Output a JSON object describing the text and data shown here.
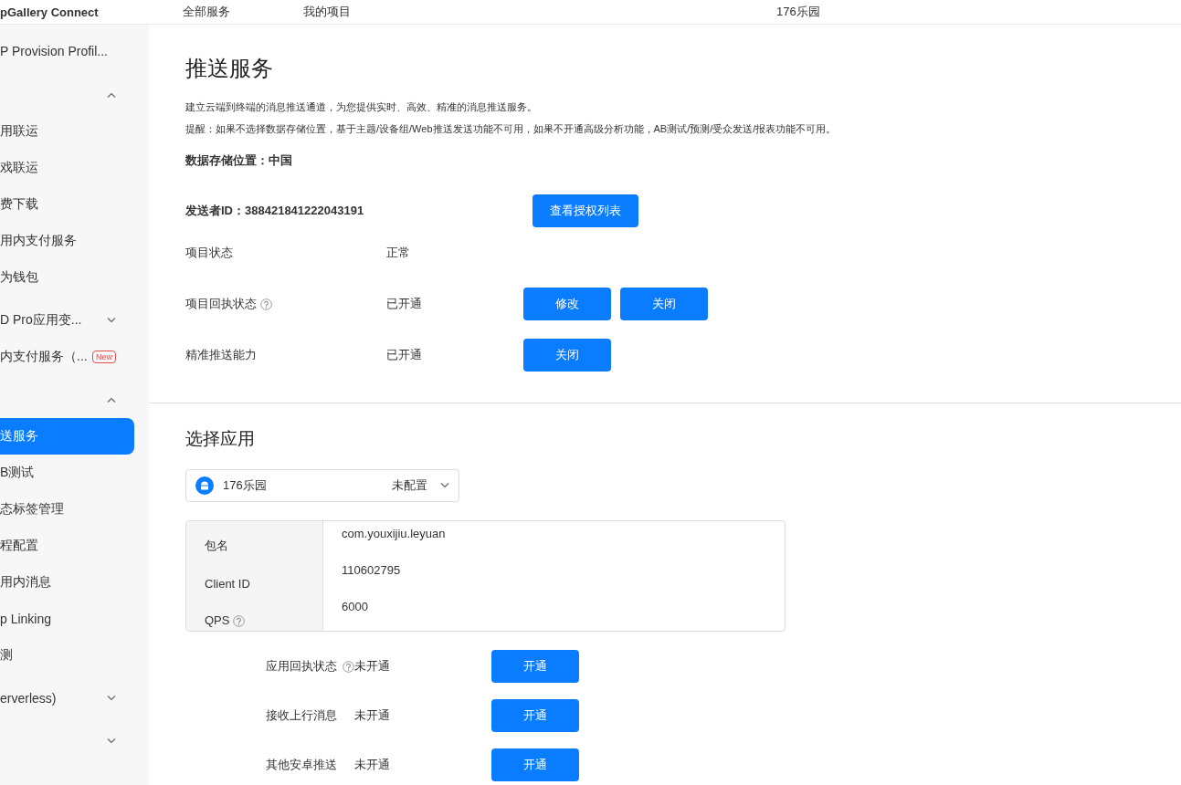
{
  "header": {
    "brand": "pGallery Connect",
    "nav": [
      "全部服务",
      "我的项目"
    ],
    "project": "176乐园"
  },
  "sidebar": {
    "items": [
      {
        "kind": "item",
        "label": "P Provision Profil...",
        "selected": false
      },
      {
        "kind": "group",
        "expanded": true
      },
      {
        "kind": "item",
        "label": "用联运",
        "selected": false
      },
      {
        "kind": "item",
        "label": "戏联运",
        "selected": false
      },
      {
        "kind": "item",
        "label": "费下载",
        "selected": false
      },
      {
        "kind": "item",
        "label": "用内支付服务",
        "selected": false
      },
      {
        "kind": "item",
        "label": "为钱包",
        "selected": false
      },
      {
        "kind": "group",
        "label": "D Pro应用变...",
        "expanded": false
      },
      {
        "kind": "item",
        "label": "内支付服务（...",
        "selected": false,
        "badge": "New"
      },
      {
        "kind": "group",
        "expanded": true
      },
      {
        "kind": "item",
        "label": "送服务",
        "selected": true
      },
      {
        "kind": "item",
        "label": "B测试",
        "selected": false
      },
      {
        "kind": "item",
        "label": "态标签管理",
        "selected": false
      },
      {
        "kind": "item",
        "label": "程配置",
        "selected": false
      },
      {
        "kind": "item",
        "label": "用内消息",
        "selected": false
      },
      {
        "kind": "item",
        "label": "p Linking",
        "selected": false
      },
      {
        "kind": "item",
        "label": "测",
        "selected": false
      },
      {
        "kind": "group",
        "label": "erverless)",
        "expanded": false
      },
      {
        "kind": "group",
        "expanded": false
      }
    ]
  },
  "main": {
    "title": "推送服务",
    "description": "建立云端到终端的消息推送通道，为您提供实时、高效、精准的消息推送服务。",
    "notice": "提醒：如果不选择数据存储位置，基于主题/设备组/Web推送发送功能不可用，如果不开通高级分析功能，AB测试/预测/受众发送/报表功能不可用。",
    "storage": "数据存储位置：中国",
    "sender_id": "发送者ID：388421841222043191",
    "sender_button": "查看授权列表",
    "status_rows": [
      {
        "label": "项目状态",
        "help": false,
        "value": "正常",
        "buttons": []
      },
      {
        "label": "项目回执状态",
        "help": true,
        "value": "已开通",
        "buttons": [
          "修改",
          "关闭"
        ]
      },
      {
        "label": "精准推送能力",
        "help": false,
        "value": "已开通",
        "buttons": [
          "关闭"
        ]
      }
    ]
  },
  "app_section": {
    "title": "选择应用",
    "app_select": {
      "name": "176乐园",
      "status": "未配置"
    },
    "info_rows": [
      {
        "label": "包名",
        "help": false,
        "value": "com.youxijiu.leyuan"
      },
      {
        "label": "Client ID",
        "help": false,
        "value": "110602795"
      },
      {
        "label": "QPS",
        "help": true,
        "value": "6000"
      }
    ],
    "service_rows": [
      {
        "label": "应用回执状态",
        "help": true,
        "value": "未开通",
        "button": "开通"
      },
      {
        "label": "接收上行消息",
        "help": false,
        "value": "未开通",
        "button": "开通"
      },
      {
        "label": "其他安卓推送",
        "help": false,
        "value": "未开通",
        "button": "开通"
      }
    ]
  }
}
